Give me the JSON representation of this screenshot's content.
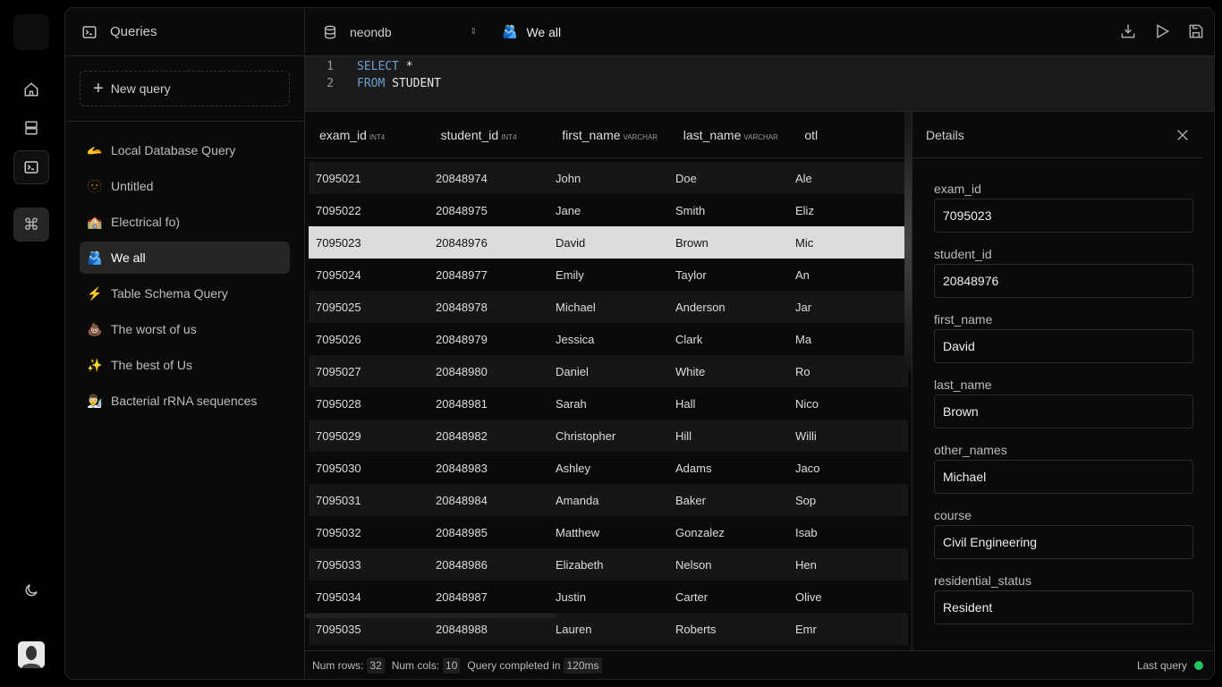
{
  "sidebar": {
    "title": "Queries",
    "new_query": "New query",
    "items": [
      {
        "emoji": "🫴",
        "label": "Local Database Query"
      },
      {
        "emoji": "🫥",
        "label": "Untitled"
      },
      {
        "emoji": "🏫",
        "label": "Electrical fo)"
      },
      {
        "emoji": "🫂",
        "label": "We all",
        "active": true
      },
      {
        "emoji": "⚡",
        "label": "Table Schema Query"
      },
      {
        "emoji": "💩",
        "label": "The worst of us"
      },
      {
        "emoji": "✨",
        "label": "The best of Us"
      },
      {
        "emoji": "👨‍🔬",
        "label": "Bacterial rRNA sequences"
      }
    ]
  },
  "toolbar": {
    "database": "neondb",
    "query_emoji": "🫂",
    "query_name": "We all"
  },
  "editor": {
    "lines": [
      {
        "num": "1",
        "kw": "SELECT",
        "rest": " *"
      },
      {
        "num": "2",
        "kw": "FROM",
        "rest": " STUDENT"
      }
    ]
  },
  "grid": {
    "columns": [
      {
        "name": "exam_id",
        "type": "INT4"
      },
      {
        "name": "student_id",
        "type": "INT4"
      },
      {
        "name": "first_name",
        "type": "VARCHAR"
      },
      {
        "name": "last_name",
        "type": "VARCHAR"
      },
      {
        "name": "otl",
        "type": ""
      }
    ],
    "rows": [
      [
        "7095021",
        "20848974",
        "John",
        "Doe",
        "Ale"
      ],
      [
        "7095022",
        "20848975",
        "Jane",
        "Smith",
        "Eliz"
      ],
      [
        "7095023",
        "20848976",
        "David",
        "Brown",
        "Mic"
      ],
      [
        "7095024",
        "20848977",
        "Emily",
        "Taylor",
        "An"
      ],
      [
        "7095025",
        "20848978",
        "Michael",
        "Anderson",
        "Jar"
      ],
      [
        "7095026",
        "20848979",
        "Jessica",
        "Clark",
        "Ma"
      ],
      [
        "7095027",
        "20848980",
        "Daniel",
        "White",
        "Ro"
      ],
      [
        "7095028",
        "20848981",
        "Sarah",
        "Hall",
        "Nico"
      ],
      [
        "7095029",
        "20848982",
        "Christopher",
        "Hill",
        "Willi"
      ],
      [
        "7095030",
        "20848983",
        "Ashley",
        "Adams",
        "Jaco"
      ],
      [
        "7095031",
        "20848984",
        "Amanda",
        "Baker",
        "Sop"
      ],
      [
        "7095032",
        "20848985",
        "Matthew",
        "Gonzalez",
        "Isab"
      ],
      [
        "7095033",
        "20848986",
        "Elizabeth",
        "Nelson",
        "Hen"
      ],
      [
        "7095034",
        "20848987",
        "Justin",
        "Carter",
        "Olive"
      ],
      [
        "7095035",
        "20848988",
        "Lauren",
        "Roberts",
        "Emr"
      ]
    ],
    "selected_row": 2
  },
  "details": {
    "title": "Details",
    "fields": [
      {
        "label": "exam_id",
        "value": "7095023"
      },
      {
        "label": "student_id",
        "value": "20848976"
      },
      {
        "label": "first_name",
        "value": "David"
      },
      {
        "label": "last_name",
        "value": "Brown"
      },
      {
        "label": "other_names",
        "value": "Michael"
      },
      {
        "label": "course",
        "value": "Civil Engineering"
      },
      {
        "label": "residential_status",
        "value": "Resident"
      }
    ]
  },
  "status": {
    "rows_label": "Num rows:",
    "rows": "32",
    "cols_label": "Num cols:",
    "cols": "10",
    "completed_label": "Query completed in",
    "time": "120ms",
    "last_query": "Last query",
    "status_color": "#22c55e"
  }
}
